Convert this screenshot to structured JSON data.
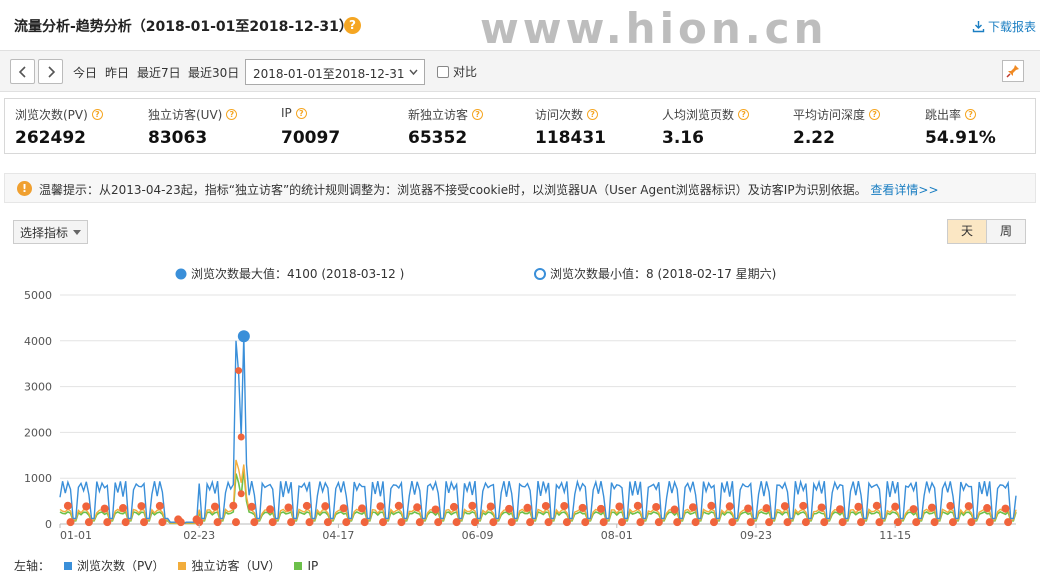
{
  "header": {
    "title": "流量分析-趋势分析（2018-01-01至2018-12-31）",
    "watermark": "www.hion.cn",
    "download_label": "下载报表"
  },
  "toolbar": {
    "quick_ranges": [
      "今日",
      "昨日",
      "最近7日",
      "最近30日"
    ],
    "date_range_value": "2018-01-01至2018-12-31",
    "compare_label": "对比"
  },
  "metrics": [
    {
      "label": "浏览次数(PV)",
      "value": "262492"
    },
    {
      "label": "独立访客(UV)",
      "value": "83063"
    },
    {
      "label": "IP",
      "value": "70097"
    },
    {
      "label": "新独立访客",
      "value": "65352"
    },
    {
      "label": "访问次数",
      "value": "118431"
    },
    {
      "label": "人均浏览页数",
      "value": "3.16"
    },
    {
      "label": "平均访问深度",
      "value": "2.22"
    },
    {
      "label": "跳出率",
      "value": "54.91%"
    }
  ],
  "notice": {
    "text": "温馨提示：从2013-04-23起，指标“独立访客”的统计规则调整为：浏览器不接受cookie时，以浏览器UA（User Agent浏览器标识）及访客IP为识别依据。",
    "link": "查看详情>>"
  },
  "controls": {
    "select_metric_label": "选择指标",
    "granularity": [
      "天",
      "周"
    ],
    "active_granularity": "天"
  },
  "colors": {
    "pv": "#3a8fd9",
    "uv": "#f2ad3c",
    "ip": "#6cc04a",
    "dot": "#f0643c",
    "accent": "#1a7ec2"
  },
  "chart_data": {
    "type": "line",
    "annotations": {
      "max": "浏览次数最大值：4100 (2018-03-12 )",
      "min": "浏览次数最小值：8 (2018-02-17 星期六)"
    },
    "ylim": [
      0,
      5000
    ],
    "yticks": [
      0,
      1000,
      2000,
      3000,
      4000,
      5000
    ],
    "xtick_labels": [
      "01-01",
      "02-23",
      "04-17",
      "06-09",
      "08-01",
      "09-23",
      "11-15"
    ],
    "legend_prefix": "左轴：",
    "series": [
      {
        "name": "浏览次数（PV）",
        "color": "#3a8fd9"
      },
      {
        "name": "独立访客（UV）",
        "color": "#f2ad3c"
      },
      {
        "name": "IP",
        "color": "#6cc04a"
      }
    ],
    "max_point": {
      "date": "2018-03-12",
      "value": 4100
    },
    "min_point": {
      "date": "2018-02-17",
      "value": 8
    },
    "weekly_pattern": {
      "pv_weekday": 780,
      "pv_weekend": 120,
      "uv_weekday": 290,
      "uv_weekend": 90,
      "ip_weekday": 240,
      "ip_weekend": 70
    },
    "spike": {
      "dates": [
        "2018-03-09",
        "2018-03-10",
        "2018-03-11",
        "2018-03-12",
        "2018-03-13"
      ],
      "pv": [
        4000,
        3300,
        1900,
        4100,
        1300
      ],
      "uv": [
        1400,
        1200,
        900,
        1300,
        600
      ],
      "ip": [
        1100,
        900,
        600,
        1200,
        500
      ]
    },
    "spring_festival_dip": {
      "start": "2018-02-12",
      "end": "2018-02-22"
    }
  }
}
